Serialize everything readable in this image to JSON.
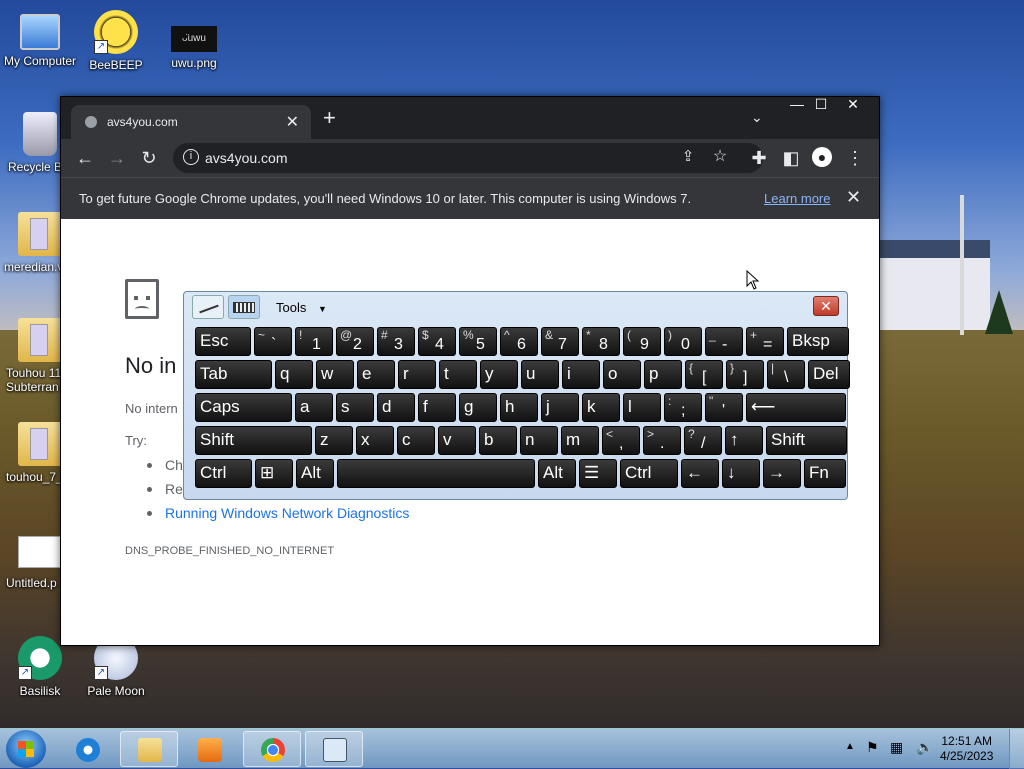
{
  "desktop": {
    "icons": [
      {
        "label": "My Computer"
      },
      {
        "label": "BeeBEEP"
      },
      {
        "label": "uwu.png"
      },
      {
        "label": "Recycle B"
      },
      {
        "label": "meredian.v"
      },
      {
        "label": "Touhou 11"
      },
      {
        "label": "Subterran"
      },
      {
        "label": "touhou_7_"
      },
      {
        "label": "Untitled.p"
      },
      {
        "label": "Basilisk"
      },
      {
        "label": "Pale Moon"
      }
    ],
    "uwu_text": "ᴗ̈uwu"
  },
  "chrome": {
    "tab_title": "avs4you.com",
    "tab_close": "✕",
    "new_tab": "+",
    "url": "avs4you.com",
    "info_message": "To get future Google Chrome updates, you'll need Windows 10 or later. This computer is using Windows 7.",
    "info_link": "Learn more",
    "info_close": "✕",
    "win_buttons": {
      "minimize": "—",
      "maximize": "☐",
      "close": "✕"
    }
  },
  "page": {
    "heading": "No in",
    "subtitle": "No intern",
    "try_label": "Try:",
    "items": [
      "Ch",
      "Re"
    ],
    "link": "Running Windows Network Diagnostics",
    "error_code": "DNS_PROBE_FINISHED_NO_INTERNET"
  },
  "osk": {
    "tools_label": "Tools",
    "tools_caret": "▼",
    "close": "✕",
    "rows": [
      [
        {
          "main": "Esc"
        },
        {
          "shift": "~",
          "main": "`"
        },
        {
          "shift": "!",
          "main": "1"
        },
        {
          "shift": "@",
          "main": "2"
        },
        {
          "shift": "#",
          "main": "3"
        },
        {
          "shift": "$",
          "main": "4"
        },
        {
          "shift": "%",
          "main": "5"
        },
        {
          "shift": "^",
          "main": "6"
        },
        {
          "shift": "&",
          "main": "7"
        },
        {
          "shift": "*",
          "main": "8"
        },
        {
          "shift": "(",
          "main": "9"
        },
        {
          "shift": ")",
          "main": "0"
        },
        {
          "shift": "_",
          "main": "-"
        },
        {
          "shift": "+",
          "main": "="
        },
        {
          "main": "Bksp"
        }
      ],
      [
        {
          "main": "Tab"
        },
        {
          "main": "q"
        },
        {
          "main": "w"
        },
        {
          "main": "e"
        },
        {
          "main": "r"
        },
        {
          "main": "t"
        },
        {
          "main": "y"
        },
        {
          "main": "u"
        },
        {
          "main": "i"
        },
        {
          "main": "o"
        },
        {
          "main": "p"
        },
        {
          "shift": "{",
          "main": "["
        },
        {
          "shift": "}",
          "main": "]"
        },
        {
          "shift": "|",
          "main": "\\"
        },
        {
          "main": "Del"
        }
      ],
      [
        {
          "main": "Caps"
        },
        {
          "main": "a"
        },
        {
          "main": "s"
        },
        {
          "main": "d"
        },
        {
          "main": "f"
        },
        {
          "main": "g"
        },
        {
          "main": "h"
        },
        {
          "main": "j"
        },
        {
          "main": "k"
        },
        {
          "main": "l"
        },
        {
          "shift": ":",
          "main": ";"
        },
        {
          "shift": "\"",
          "main": "'"
        },
        {
          "main": "⟵"
        }
      ],
      [
        {
          "main": "Shift"
        },
        {
          "main": "z"
        },
        {
          "main": "x"
        },
        {
          "main": "c"
        },
        {
          "main": "v"
        },
        {
          "main": "b"
        },
        {
          "main": "n"
        },
        {
          "main": "m"
        },
        {
          "shift": "<",
          "main": ","
        },
        {
          "shift": ">",
          "main": "."
        },
        {
          "shift": "?",
          "main": "/"
        },
        {
          "main": "↑"
        },
        {
          "main": "Shift"
        }
      ],
      [
        {
          "main": "Ctrl"
        },
        {
          "main": "⊞"
        },
        {
          "main": "Alt"
        },
        {
          "main": ""
        },
        {
          "main": "Alt"
        },
        {
          "main": "☰"
        },
        {
          "main": "Ctrl"
        },
        {
          "main": "←"
        },
        {
          "main": "↓"
        },
        {
          "main": "→"
        },
        {
          "main": "Fn"
        }
      ]
    ]
  },
  "taskbar": {
    "time": "12:51 AM",
    "date": "4/25/2023",
    "apps": [
      "internet-explorer",
      "file-explorer",
      "media-player",
      "chrome",
      "on-screen-keyboard"
    ]
  }
}
